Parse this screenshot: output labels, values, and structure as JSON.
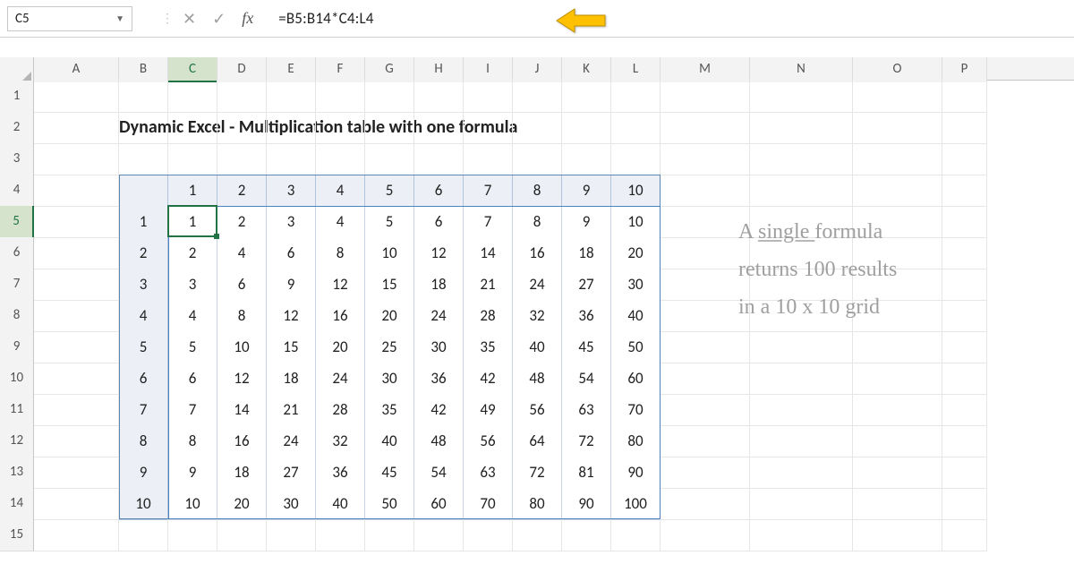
{
  "formula_bar": {
    "cell_ref": "C5",
    "fx_label": "fx",
    "formula": "=B5:B14*C4:L4"
  },
  "col_letters": [
    "A",
    "B",
    "C",
    "D",
    "E",
    "F",
    "G",
    "H",
    "I",
    "J",
    "K",
    "L",
    "M",
    "N",
    "O",
    "P"
  ],
  "selected_col": "C",
  "selected_row": "5",
  "row_numbers": [
    "1",
    "2",
    "3",
    "4",
    "5",
    "6",
    "7",
    "8",
    "9",
    "10",
    "11",
    "12",
    "13",
    "14",
    "15"
  ],
  "title": "Dynamic Excel - Multiplication table with one formula",
  "table": {
    "col_headers": [
      "1",
      "2",
      "3",
      "4",
      "5",
      "6",
      "7",
      "8",
      "9",
      "10"
    ],
    "row_headers": [
      "1",
      "2",
      "3",
      "4",
      "5",
      "6",
      "7",
      "8",
      "9",
      "10"
    ],
    "grid": [
      [
        1,
        2,
        3,
        4,
        5,
        6,
        7,
        8,
        9,
        10
      ],
      [
        2,
        4,
        6,
        8,
        10,
        12,
        14,
        16,
        18,
        20
      ],
      [
        3,
        6,
        9,
        12,
        15,
        18,
        21,
        24,
        27,
        30
      ],
      [
        4,
        8,
        12,
        16,
        20,
        24,
        28,
        32,
        36,
        40
      ],
      [
        5,
        10,
        15,
        20,
        25,
        30,
        35,
        40,
        45,
        50
      ],
      [
        6,
        12,
        18,
        24,
        30,
        36,
        42,
        48,
        54,
        60
      ],
      [
        7,
        14,
        21,
        28,
        35,
        42,
        49,
        56,
        63,
        70
      ],
      [
        8,
        16,
        24,
        32,
        40,
        48,
        56,
        64,
        72,
        80
      ],
      [
        9,
        18,
        27,
        36,
        45,
        54,
        63,
        72,
        81,
        90
      ],
      [
        10,
        20,
        30,
        40,
        50,
        60,
        70,
        80,
        90,
        100
      ]
    ]
  },
  "annotation": {
    "line1a": "A ",
    "line1b": "single ",
    "line1c": "formula",
    "line2": "returns 100 results",
    "line3": "in a 10 x 10 grid"
  },
  "chart_data": {
    "type": "table",
    "title": "Multiplication table 10×10",
    "row_labels": [
      "1",
      "2",
      "3",
      "4",
      "5",
      "6",
      "7",
      "8",
      "9",
      "10"
    ],
    "col_labels": [
      "1",
      "2",
      "3",
      "4",
      "5",
      "6",
      "7",
      "8",
      "9",
      "10"
    ],
    "values": [
      [
        1,
        2,
        3,
        4,
        5,
        6,
        7,
        8,
        9,
        10
      ],
      [
        2,
        4,
        6,
        8,
        10,
        12,
        14,
        16,
        18,
        20
      ],
      [
        3,
        6,
        9,
        12,
        15,
        18,
        21,
        24,
        27,
        30
      ],
      [
        4,
        8,
        12,
        16,
        20,
        24,
        28,
        32,
        36,
        40
      ],
      [
        5,
        10,
        15,
        20,
        25,
        30,
        35,
        40,
        45,
        50
      ],
      [
        6,
        12,
        18,
        24,
        30,
        36,
        42,
        48,
        54,
        60
      ],
      [
        7,
        14,
        21,
        28,
        35,
        42,
        49,
        56,
        63,
        70
      ],
      [
        8,
        16,
        24,
        32,
        40,
        48,
        56,
        64,
        72,
        80
      ],
      [
        9,
        18,
        27,
        36,
        45,
        54,
        63,
        72,
        81,
        90
      ],
      [
        10,
        20,
        30,
        40,
        50,
        60,
        70,
        80,
        90,
        100
      ]
    ]
  }
}
